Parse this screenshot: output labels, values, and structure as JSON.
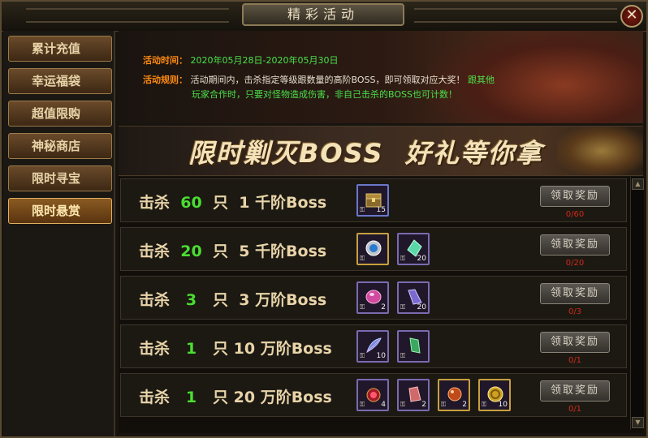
{
  "window": {
    "title": "精彩活动",
    "close_symbol": "✕"
  },
  "sidebar": {
    "items": [
      {
        "label": "累计充值",
        "active": false
      },
      {
        "label": "幸运福袋",
        "active": false
      },
      {
        "label": "超值限购",
        "active": false
      },
      {
        "label": "神秘商店",
        "active": false
      },
      {
        "label": "限时寻宝",
        "active": false
      },
      {
        "label": "限时悬赏",
        "active": true
      }
    ]
  },
  "info": {
    "time_label": "活动时间：",
    "time_value": "2020年05月28日-2020年05月30日",
    "rule_label": "活动规则：",
    "rule_text": "活动期间内，击杀指定等级跟数量的高阶BOSS，即可领取对应大奖！",
    "rule_green_1": "跟其他",
    "rule_green_2": "玩家合作时，只要对怪物造成伤害，非自己击杀的BOSS也可计数！"
  },
  "banner": {
    "text": "限时剿灭BOSS  好礼等你拿"
  },
  "rewards": [
    {
      "kill_prefix": "击杀",
      "count": "60",
      "unit": "只",
      "level": "1",
      "tier": "千阶Boss",
      "items": [
        {
          "icon": "treasure-chest-icon",
          "count": "15",
          "lock": "⚿"
        }
      ],
      "button": "领取奖励",
      "progress": "0/60"
    },
    {
      "kill_prefix": "击杀",
      "count": "20",
      "unit": "只",
      "level": "5",
      "tier": "千阶Boss",
      "items": [
        {
          "icon": "blue-orb-icon",
          "count": "",
          "lock": "⚿"
        },
        {
          "icon": "green-crystal-icon",
          "count": "20",
          "lock": "⚿"
        }
      ],
      "button": "领取奖励",
      "progress": "0/20"
    },
    {
      "kill_prefix": "击杀",
      "count": "3",
      "unit": "只",
      "level": "3",
      "tier": "万阶Boss",
      "items": [
        {
          "icon": "pink-gem-icon",
          "count": "2",
          "lock": "⚿"
        },
        {
          "icon": "purple-crystal-icon",
          "count": "20",
          "lock": "⚿"
        }
      ],
      "button": "领取奖励",
      "progress": "0/3"
    },
    {
      "kill_prefix": "击杀",
      "count": "1",
      "unit": "只",
      "level": "10",
      "tier": "万阶Boss",
      "items": [
        {
          "icon": "feather-icon",
          "count": "10",
          "lock": "⚿"
        },
        {
          "icon": "green-crystal-icon",
          "count": "",
          "lock": "⚿"
        }
      ],
      "button": "领取奖励",
      "progress": "0/1"
    },
    {
      "kill_prefix": "击杀",
      "count": "1",
      "unit": "只",
      "level": "20",
      "tier": "万阶Boss",
      "items": [
        {
          "icon": "red-jewel-icon",
          "count": "4",
          "lock": "⚿"
        },
        {
          "icon": "red-crystal-icon",
          "count": "2",
          "lock": "⚿"
        },
        {
          "icon": "red-orb-icon",
          "count": "2",
          "lock": "⚿"
        },
        {
          "icon": "gold-coin-icon",
          "count": "10",
          "lock": "⚿"
        }
      ],
      "button": "领取奖励",
      "progress": "0/1"
    }
  ],
  "scrollbar": {
    "up_symbol": "▲",
    "down_symbol": "▼"
  },
  "colors": {
    "accent_orange": "#ff8a10",
    "green": "#4ae04a",
    "progress_red": "#d02a1a",
    "number_green": "#4ade30"
  }
}
